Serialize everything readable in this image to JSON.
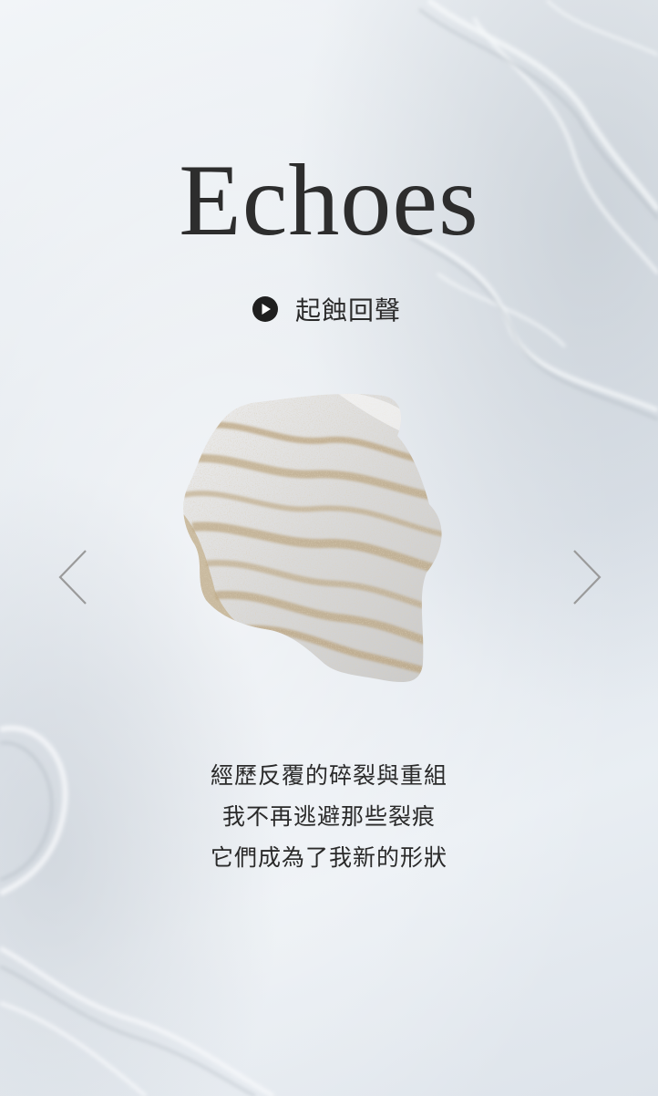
{
  "title": "Echoes",
  "play": {
    "label": "起蝕回聲",
    "icon": "play-circle-icon"
  },
  "artwork": {
    "description_icon": "marbled-stone-image"
  },
  "navigation": {
    "prev_icon": "chevron-left-icon",
    "next_icon": "chevron-right-icon"
  },
  "poem": {
    "lines": [
      "經歷反覆的碎裂與重組",
      "我不再逃避那些裂痕",
      "它們成為了我新的形狀"
    ]
  },
  "colors": {
    "text": "#2d2d2d",
    "stone_gold": "#b9a27c",
    "stone_base": "#dcdcdc",
    "arrow": "#9a9a9a"
  }
}
